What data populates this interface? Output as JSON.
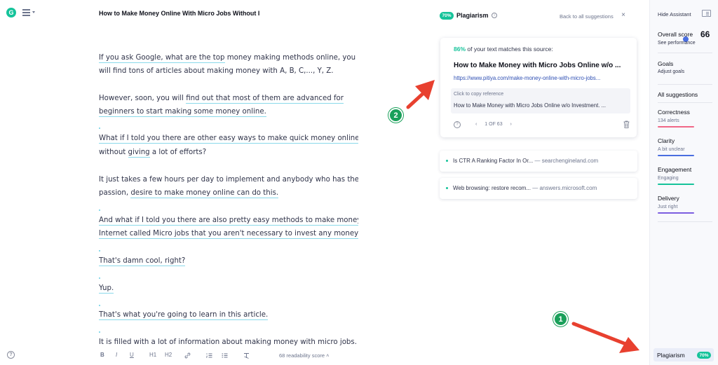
{
  "app": {
    "logo_letter": "G"
  },
  "document": {
    "title": "How to Make Money Online With Micro Jobs Without I",
    "paragraphs": [
      {
        "plain_pre": "",
        "underlined": "If you ask Google, what are the top",
        "plain_post": " money making methods online, you"
      },
      {
        "plain_pre": "will find tons of articles about making money with A, B, C,..., Y, Z.",
        "underlined": "",
        "plain_post": ""
      },
      {
        "plain_pre": "However, soon, you will ",
        "underlined": "find out that most of them are advanced for",
        "plain_post": ""
      },
      {
        "plain_pre": "",
        "underlined": "beginners to start making some money online.",
        "plain_post": ""
      },
      {
        "plain_pre": "",
        "underlined": "What if I told you there are other easy ways to make quick money online",
        "plain_post": ""
      },
      {
        "plain_pre": "without ",
        "underlined": "giving",
        "plain_post": " a lot of efforts?"
      },
      {
        "plain_pre": "It just takes a few hours per day to implement and anybody who has the",
        "underlined": "",
        "plain_post": ""
      },
      {
        "plain_pre": "passion, ",
        "underlined": "desire to make money online can do this.",
        "plain_post": ""
      },
      {
        "plain_pre": "",
        "underlined": "And what if I told you there are also pretty easy methods to make money",
        "plain_post": ""
      },
      {
        "plain_pre": "",
        "underlined": "Internet called Micro jobs that you aren't necessary to invest any money?",
        "plain_post": ""
      },
      {
        "plain_pre": "",
        "underlined": "That's damn cool, right?",
        "plain_post": ""
      },
      {
        "plain_pre": "",
        "underlined": "Yup.",
        "plain_post": ""
      },
      {
        "plain_pre": "",
        "underlined": "That's what you're going to learn in this article.",
        "plain_post": ""
      },
      {
        "plain_pre": "It is filled with a lot of information about making money with micro jobs.",
        "underlined": "",
        "plain_post": ""
      }
    ]
  },
  "toolbar": {
    "bold": "B",
    "italic": "I",
    "underline": "U",
    "h1": "H1",
    "h2": "H2",
    "readability": "68 readability score"
  },
  "plagiarism_panel": {
    "badge": "70%",
    "title": "Plagiarism",
    "back_link": "Back to all suggestions",
    "close": "×",
    "match_percent": "86%",
    "match_text": " of your text matches this source:",
    "source_title": "How to Make Money with Micro Jobs Online w/o ...",
    "source_url": "https://www.pitiya.com/make-money-online-with-micro-jobs...",
    "copy_label": "Click to copy reference",
    "copy_reference": "How to Make Money with Micro Jobs Online w/o Investment. ...",
    "pager": {
      "prev": "‹",
      "page": "1 OF 63",
      "next": "›"
    },
    "other_sources": [
      {
        "title": "Is CTR A Ranking Factor In Or...",
        "domain": " — searchengineland.com"
      },
      {
        "title": "Web browsing: restore recom...",
        "domain": " — answers.microsoft.com"
      }
    ]
  },
  "assistant": {
    "hide": "Hide Assistant",
    "overall_label": "Overall score",
    "overall_score": "66",
    "see_performance": "See performance",
    "goals": "Goals",
    "adjust_goals": "Adjust goals",
    "all_suggestions": "All suggestions",
    "categories": [
      {
        "name": "Correctness",
        "sub": "134 alerts",
        "color": "#f06787"
      },
      {
        "name": "Clarity",
        "sub": "A bit unclear",
        "color": "#4a6ee0"
      },
      {
        "name": "Engagement",
        "sub": "Engaging",
        "color": "#15c39a"
      },
      {
        "name": "Delivery",
        "sub": "Just right",
        "color": "#7c5ee0"
      }
    ],
    "plagiarism_label": "Plagiarism",
    "plagiarism_badge": "70%"
  },
  "callouts": {
    "one": "1",
    "two": "2"
  },
  "colors": {
    "accent_green": "#15c39a",
    "link_blue": "#2e4fb3",
    "arrow_red": "#e8402f",
    "callout_green": "#1aa05a"
  },
  "icons": [
    "grammarly-logo-icon",
    "menu-icon",
    "help-icon",
    "info-icon",
    "close-icon",
    "trash-icon",
    "hide-assistant-icon"
  ]
}
